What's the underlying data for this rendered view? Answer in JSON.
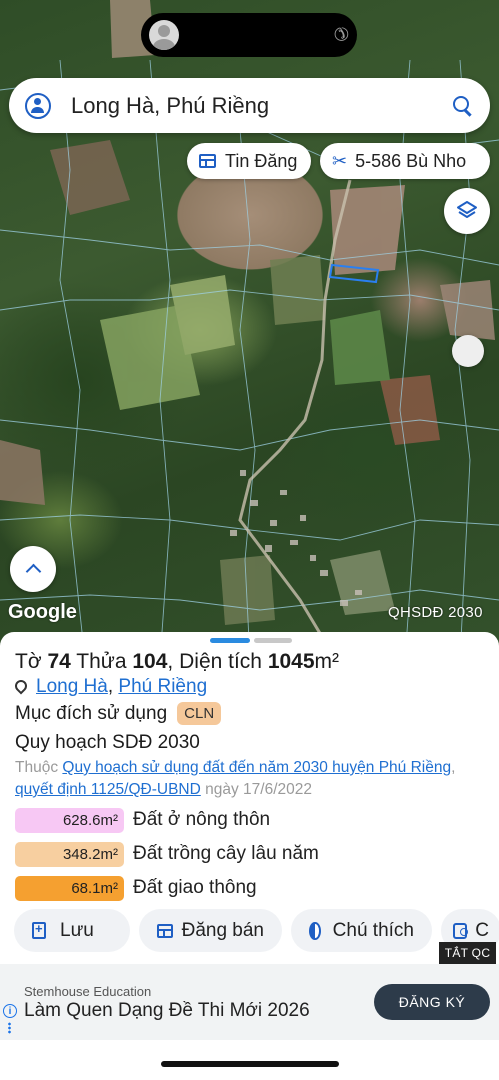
{
  "search": {
    "value": "Long Hà, Phú Riềng"
  },
  "chips": [
    {
      "label": "Tin Đăng",
      "icon": "table-icon"
    },
    {
      "label": "5-586 Bù Nho",
      "icon": "crop-icon"
    }
  ],
  "map": {
    "attribution": "Google",
    "layer_label": "QHSDĐ 2030"
  },
  "parcel": {
    "to_label": "Tờ",
    "to_value": "74",
    "thua_label": "Thửa",
    "thua_value": "104",
    "area_label": "Diện tích",
    "area_value": "1045",
    "area_unit": "m²",
    "commune": "Long Hà",
    "separator": ",",
    "district": "Phú Riềng",
    "purpose_label": "Mục đích sử dụng",
    "purpose_code": "CLN",
    "plan_title": "Quy hoạch SDĐ 2030",
    "source_prefix": "Thuộc",
    "source_link": "Quy hoạch sử dụng đất đến năm 2030 huyện Phú Riềng",
    "source_sep": ",",
    "decision_link": "quyết định 1125/QĐ-UBND",
    "decision_date": "ngày 17/6/2022"
  },
  "areas": [
    {
      "value": "628.6m²",
      "label": "Đất ở nông thôn",
      "color": "#f7c8f4"
    },
    {
      "value": "348.2m²",
      "label": "Đất trồng cây lâu năm",
      "color": "#f7cfa0"
    },
    {
      "value": "68.1m²",
      "label": "Đất giao thông",
      "color": "#f5a030"
    }
  ],
  "actions": [
    {
      "label": "Lưu",
      "icon": "add-doc-icon"
    },
    {
      "label": "Đăng bán",
      "icon": "table-icon"
    },
    {
      "label": "Chú thích",
      "icon": "half-circle-icon"
    },
    {
      "label": "C",
      "icon": "camera-icon"
    }
  ],
  "ad": {
    "close_label": "TẮT QC",
    "brand": "Stemhouse Education",
    "title": "Làm Quen Dạng Đề Thi Mới 2026",
    "cta": "ĐĂNG KÝ",
    "info_glyph": "i"
  },
  "colors": {
    "accent": "#1f5fc4",
    "link": "#1f6fd1",
    "sheet_handle": "#2a8be0"
  }
}
